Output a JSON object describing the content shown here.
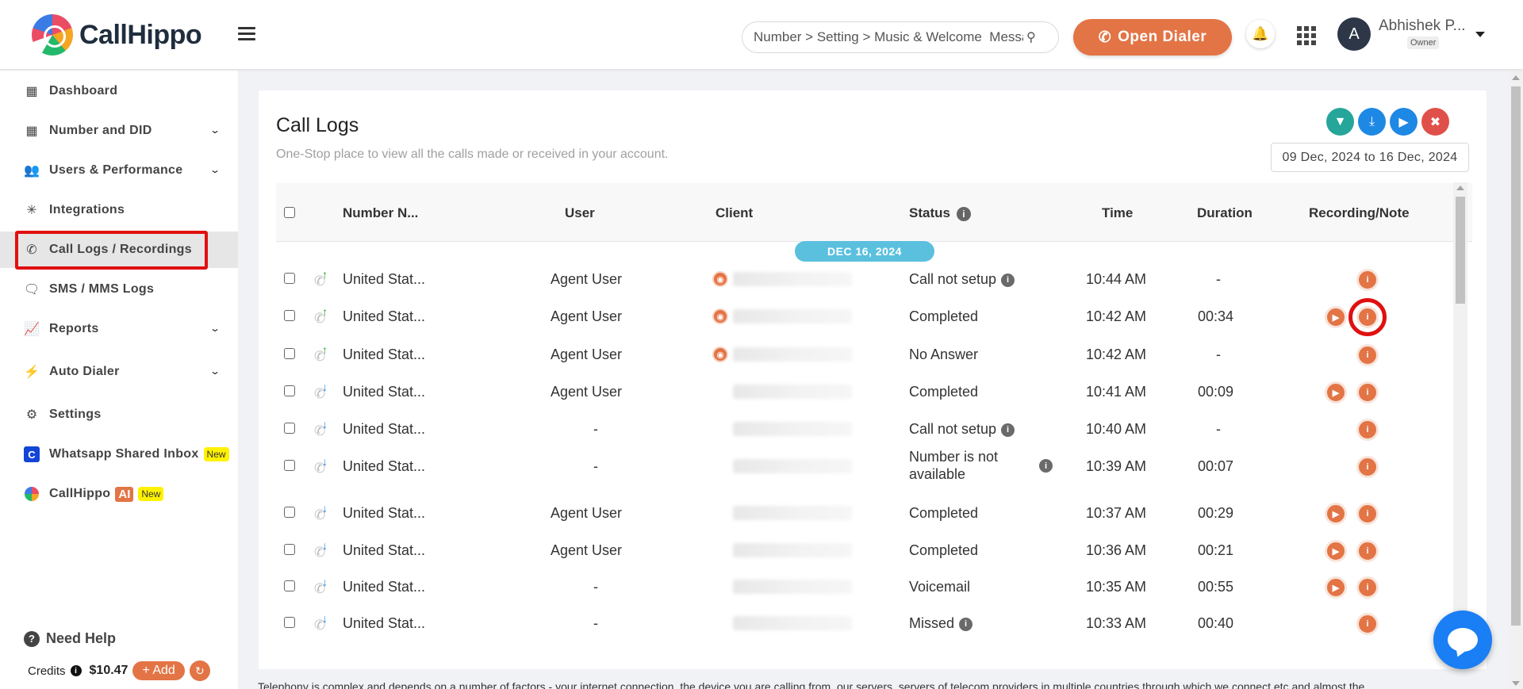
{
  "header": {
    "brand": "CallHippo",
    "search_value": "Number > Setting > Music & Welcome  Message",
    "open_dialer_label": "Open Dialer",
    "user_name": "Abhishek P...",
    "user_role": "Owner",
    "avatar_initial": "A"
  },
  "sidebar": {
    "items": [
      {
        "label": "Dashboard",
        "icon": "dashboard-icon",
        "chevron": false
      },
      {
        "label": "Number and DID",
        "icon": "building-icon",
        "chevron": true
      },
      {
        "label": "Users & Performance",
        "icon": "users-icon",
        "chevron": true
      },
      {
        "label": "Integrations",
        "icon": "integrations-icon",
        "chevron": false
      },
      {
        "label": "Call Logs / Recordings",
        "icon": "call-logs-icon",
        "chevron": false,
        "active": true
      },
      {
        "label": "SMS / MMS Logs",
        "icon": "sms-icon",
        "chevron": false
      },
      {
        "label": "Reports",
        "icon": "reports-icon",
        "chevron": true
      },
      {
        "label": "Auto Dialer",
        "icon": "bolt-icon",
        "chevron": true
      },
      {
        "label": "Settings",
        "icon": "gear-icon",
        "chevron": false
      },
      {
        "label": "Whatsapp Shared Inbox",
        "icon": "whatsapp-inbox-icon",
        "badge": "New"
      },
      {
        "label": "CallHippo",
        "icon": "callhippo-ai-icon",
        "ai_badge": "AI",
        "badge": "New"
      }
    ],
    "need_help": "Need Help",
    "credits_label": "Credits",
    "credits_amount": "$10.47",
    "add_label": "+ Add"
  },
  "main": {
    "title": "Call Logs",
    "subtitle": "One-Stop place to view all the calls made or received in your account.",
    "date_range": "09 Dec, 2024 to 16 Dec, 2024",
    "actions": [
      "filter",
      "download",
      "play-all",
      "delete"
    ],
    "columns": [
      "Number N...",
      "User",
      "Client",
      "Status",
      "Time",
      "Duration",
      "Recording/Note"
    ],
    "date_group": "DEC 16, 2024",
    "rows": [
      {
        "direction": "outgoing",
        "number": "United Stat...",
        "user": "Agent User",
        "web": true,
        "status": "Call not setup",
        "status_info": true,
        "time": "10:44 AM",
        "duration": "-",
        "recording": false
      },
      {
        "direction": "outgoing",
        "number": "United Stat...",
        "user": "Agent User",
        "web": true,
        "status": "Completed",
        "status_info": false,
        "time": "10:42 AM",
        "duration": "00:34",
        "recording": true,
        "highlighted": true
      },
      {
        "direction": "outgoing",
        "number": "United Stat...",
        "user": "Agent User",
        "web": true,
        "status": "No Answer",
        "status_info": false,
        "time": "10:42 AM",
        "duration": "-",
        "recording": false
      },
      {
        "direction": "incoming",
        "number": "United Stat...",
        "user": "Agent User",
        "web": false,
        "status": "Completed",
        "status_info": false,
        "time": "10:41 AM",
        "duration": "00:09",
        "recording": true
      },
      {
        "direction": "incoming",
        "number": "United Stat...",
        "user": "-",
        "web": false,
        "status": "Call not setup",
        "status_info": true,
        "time": "10:40 AM",
        "duration": "-",
        "recording": false
      },
      {
        "direction": "incoming",
        "number": "United Stat...",
        "user": "-",
        "web": false,
        "status": "Number is not available",
        "status_info": true,
        "time": "10:39 AM",
        "duration": "00:07",
        "recording": false
      },
      {
        "direction": "incoming",
        "number": "United Stat...",
        "user": "Agent User",
        "web": false,
        "status": "Completed",
        "status_info": false,
        "time": "10:37 AM",
        "duration": "00:29",
        "recording": true
      },
      {
        "direction": "incoming",
        "number": "United Stat...",
        "user": "Agent User",
        "web": false,
        "status": "Completed",
        "status_info": false,
        "time": "10:36 AM",
        "duration": "00:21",
        "recording": true
      },
      {
        "direction": "incoming",
        "number": "United Stat...",
        "user": "-",
        "web": false,
        "status": "Voicemail",
        "status_info": false,
        "time": "10:35 AM",
        "duration": "00:55",
        "recording": true
      },
      {
        "direction": "incoming",
        "number": "United Stat...",
        "user": "-",
        "web": false,
        "status": "Missed",
        "status_info": true,
        "time": "10:33 AM",
        "duration": "00:40",
        "recording": false
      }
    ]
  },
  "footer_note": "Telephony is complex and depends on a number of factors - your internet connection, the device you are calling from, our servers, servers of telecom providers in multiple countries through which we connect etc and almost the",
  "colors": {
    "accent": "#e37445",
    "date_pill": "#5bc0de",
    "filter": "#26a69a",
    "download": "#1e88e5",
    "play": "#1e88e5",
    "delete": "#e0504a",
    "chat": "#1a7ef5",
    "outgoing_arrow": "#22a722",
    "incoming_arrow": "#1e88e5"
  }
}
